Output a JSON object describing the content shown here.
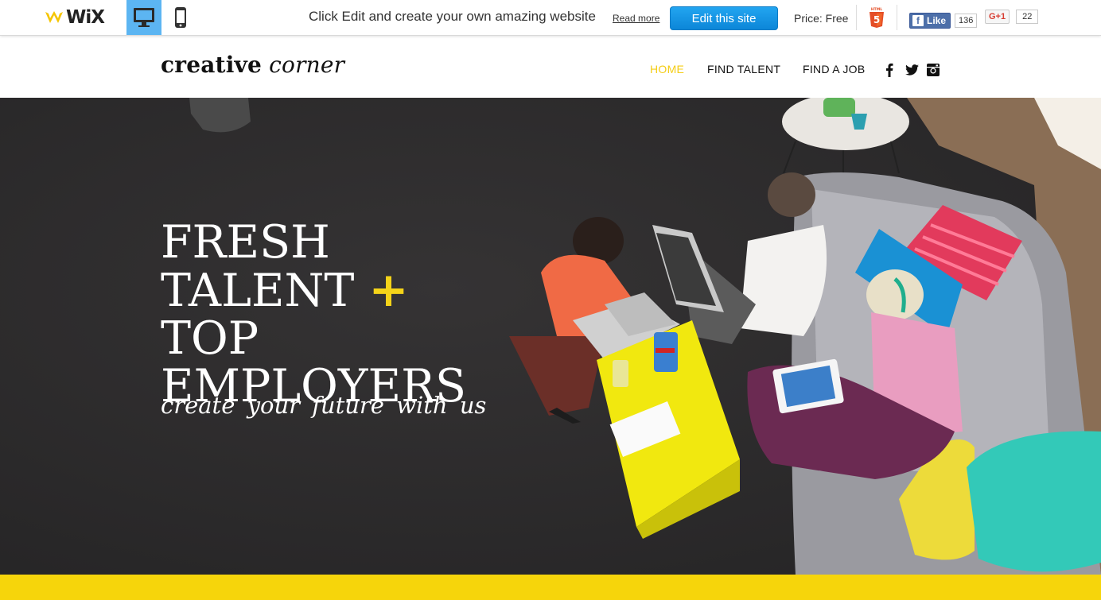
{
  "wixbar": {
    "logo": "WiX",
    "promo_text": "Click Edit and create your own amazing website",
    "read_more": "Read more",
    "edit_button": "Edit this site",
    "price": "Price: Free",
    "facebook": {
      "label": "Like",
      "count": "136"
    },
    "gplus": {
      "label": "G+1",
      "count": "22"
    },
    "colors": {
      "accent": "#5cb5f2",
      "edit_button": "#1596e4"
    }
  },
  "header": {
    "brand_bold": "creative",
    "brand_italic": "corner",
    "nav": [
      {
        "label": "HOME",
        "active": true
      },
      {
        "label": "FIND TALENT",
        "active": false
      },
      {
        "label": "FIND A JOB",
        "active": false
      }
    ],
    "social_icons": [
      "facebook-icon",
      "twitter-icon",
      "instagram-icon"
    ],
    "colors": {
      "active_nav": "#f4cd16"
    }
  },
  "hero": {
    "title_lines": [
      "FRESH",
      "TALENT",
      "TOP",
      "EMPLOYERS"
    ],
    "plus": "+",
    "subtitle": "create your future with us",
    "colors": {
      "highlight": "#f4d319",
      "strip": "#f6d50b"
    }
  }
}
